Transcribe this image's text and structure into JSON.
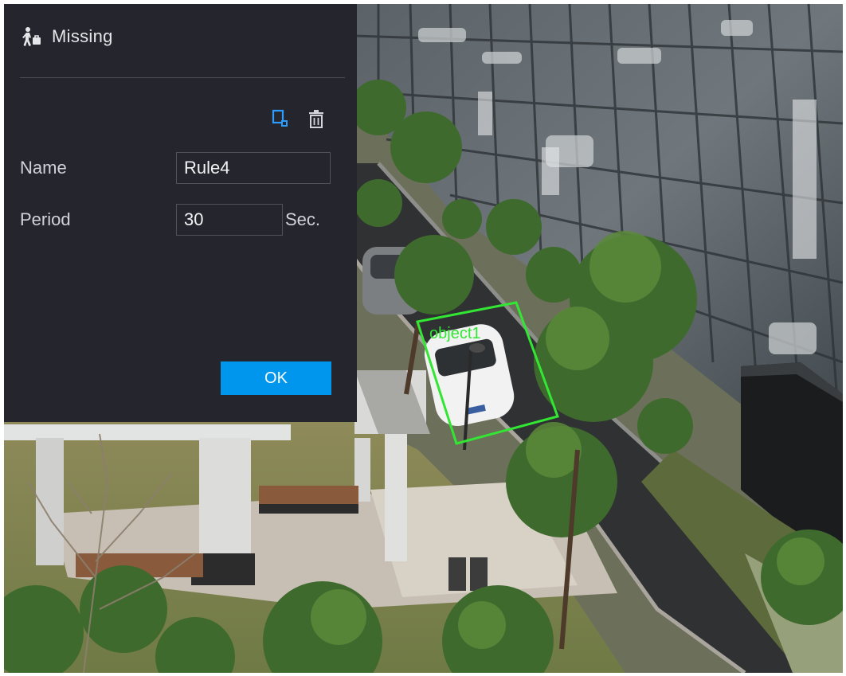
{
  "dialog": {
    "title": "Missing",
    "title_icon": "person-with-bag-icon",
    "toolbar": {
      "draw_icon": "draw-region-icon",
      "delete_icon": "trash-icon"
    },
    "name_label": "Name",
    "name_value": "Rule4",
    "period_label": "Period",
    "period_value": "30",
    "period_unit": "Sec.",
    "ok_label": "OK"
  },
  "video": {
    "object_label": "object1",
    "object_color": "#33e633"
  },
  "colors": {
    "panel_bg": "#25252e",
    "accent": "#0096ee",
    "draw_icon": "#2d9cff"
  }
}
